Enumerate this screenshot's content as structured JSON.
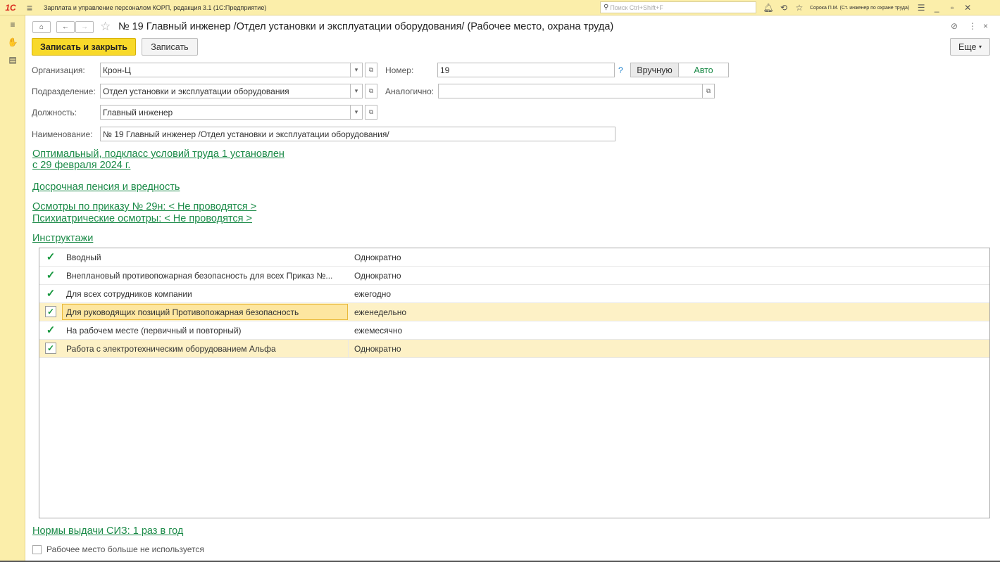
{
  "app": {
    "logo": "1С",
    "title": "Зарплата и управление персоналом КОРП, редакция 3.1  (1С:Предприятие)",
    "search_placeholder": "Поиск Ctrl+Shift+F",
    "user": "Сорока П.М. (Ст. инженер по охране труда)"
  },
  "form": {
    "title": "№ 19 Главный инженер /Отдел установки и эксплуатации оборудования/ (Рабочее место, охрана труда)",
    "save_close_label": "Записать и закрыть",
    "save_label": "Записать",
    "more_label": "Еще"
  },
  "fields": {
    "org_label": "Организация:",
    "org_value": "Крон-Ц",
    "number_label": "Номер:",
    "number_value": "19",
    "manual_label": "Вручную",
    "auto_label": "Авто",
    "dept_label": "Подразделение:",
    "dept_value": "Отдел установки и эксплуатации оборудования",
    "similar_label": "Аналогично:",
    "similar_value": "",
    "position_label": "Должность:",
    "position_value": "Главный инженер",
    "name_label": "Наименование:",
    "name_value": "№ 19 Главный инженер /Отдел установки и эксплуатации оборудования/"
  },
  "links": {
    "conditions_line1": "Оптимальный, подкласс условий труда 1 установлен",
    "conditions_line2": "с 29 февраля 2024 г.",
    "pension": "Досрочная пенсия и вредность",
    "exams": "Осмотры по приказу № 29н: < Не проводятся >",
    "psych": "Психиатрические осмотры: < Не проводятся >",
    "briefings": "Инструктажи",
    "ppe": "Нормы выдачи СИЗ: 1 раз в год"
  },
  "briefings": [
    {
      "name": "Вводный",
      "frequency": "Однократно",
      "checked": true
    },
    {
      "name": "Внеплановый противопожарная безопасность для всех Приказ №...",
      "frequency": "Однократно",
      "checked": true
    },
    {
      "name": "Для всех сотрудников компании",
      "frequency": "ежегодно",
      "checked": true
    },
    {
      "name": "Для руководящих позиций Противопожарная безопасность",
      "frequency": "еженедельно",
      "checked": true
    },
    {
      "name": "На рабочем месте (первичный и повторный)",
      "frequency": "ежемесячно",
      "checked": true
    },
    {
      "name": "Работа с электротехническим оборудованием Альфа",
      "frequency": "Однократно",
      "checked": true
    }
  ],
  "footer": {
    "unused_label": "Рабочее место больше не используется"
  }
}
